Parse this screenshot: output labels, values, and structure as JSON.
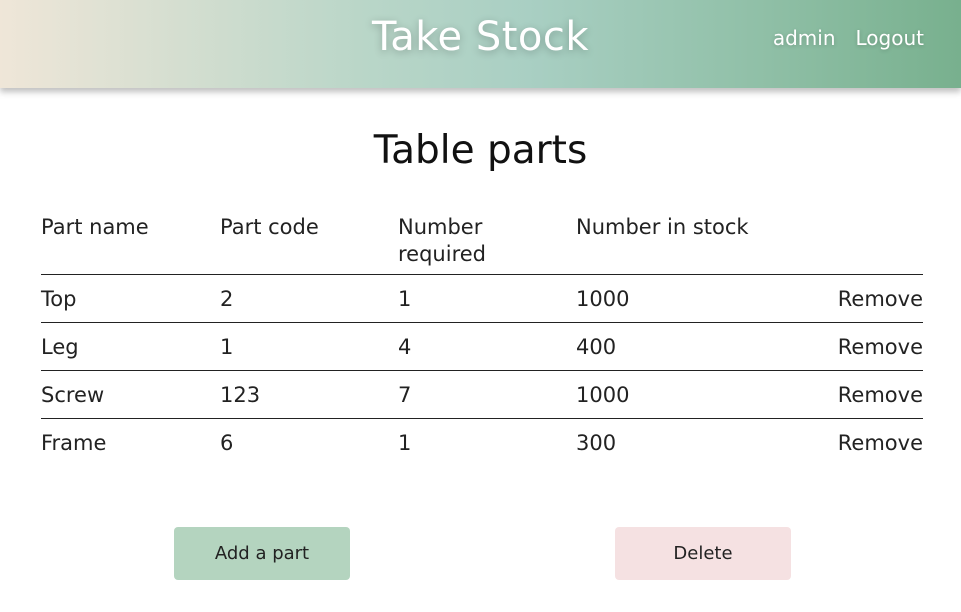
{
  "header": {
    "title": "Take Stock",
    "nav": {
      "user": "admin",
      "logout": "Logout"
    }
  },
  "page": {
    "title": "Table parts"
  },
  "table": {
    "columns": [
      "Part name",
      "Part code",
      "Number required",
      "Number in stock"
    ],
    "rows": [
      {
        "name": "Top",
        "code": "2",
        "required": "1",
        "stock": "1000",
        "action": "Remove"
      },
      {
        "name": "Leg",
        "code": "1",
        "required": "4",
        "stock": "400",
        "action": "Remove"
      },
      {
        "name": "Screw",
        "code": "123",
        "required": "7",
        "stock": "1000",
        "action": "Remove"
      },
      {
        "name": "Frame",
        "code": "6",
        "required": "1",
        "stock": "300",
        "action": "Remove"
      }
    ]
  },
  "actions": {
    "add": "Add a part",
    "delete": "Delete"
  },
  "colors": {
    "add_button": "#b4d4bf",
    "delete_button": "#f5e1e2",
    "header_start": "#efe6d8",
    "header_end": "#78b08e"
  }
}
